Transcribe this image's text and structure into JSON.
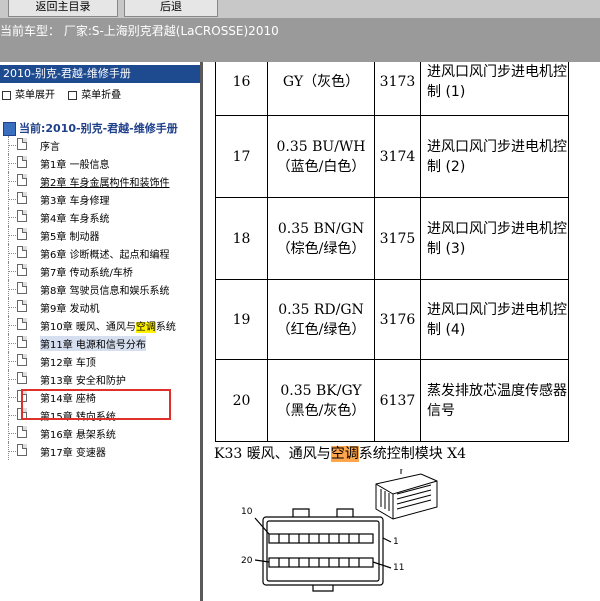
{
  "toolbar": {
    "buttons": [
      "返回主目录",
      "后退"
    ]
  },
  "model_bar": {
    "text": "当前车型：  厂家:S-上海别克君越(LaCROSSE)2010"
  },
  "sidebar": {
    "title": "2010-别克-君越-维修手册",
    "expand_label": "菜单展开",
    "collapse_label": "菜单折叠",
    "root_label": "当前:2010-别克-君越-维修手册",
    "items": [
      {
        "label": "序言"
      },
      {
        "label": "第1章 一般信息"
      },
      {
        "label": "第2章 车身金属构件和装饰件"
      },
      {
        "label": "第3章 车身修理"
      },
      {
        "label": "第4章 车身系统"
      },
      {
        "label": "第5章 制动器"
      },
      {
        "label": "第6章 诊断概述、起点和编程"
      },
      {
        "label": "第7章 传动系统/车桥"
      },
      {
        "label": "第8章 驾驶员信息和娱乐系统"
      },
      {
        "label": "第9章 发动机"
      },
      {
        "label_pre": "第10章 暖风、通风与",
        "label_hl": "空调",
        "label_post": "系统"
      },
      {
        "label": "第11章 电源和信号分布"
      },
      {
        "label": "第12章 车顶"
      },
      {
        "label": "第13章 安全和防护"
      },
      {
        "label": "第14章 座椅"
      },
      {
        "label": "第15章 转向系统"
      },
      {
        "label": "第16章 悬架系统"
      },
      {
        "label": "第17章 变速器"
      }
    ]
  },
  "content": {
    "pin_table": {
      "rows": [
        {
          "pin": "16",
          "wire": "GY（灰色）",
          "circuit": "3173",
          "function": "进风口风门步进电机控制 (1)"
        },
        {
          "pin": "17",
          "wire": "0.35 BU/WH（蓝色/白色）",
          "circuit": "3174",
          "function": "进风口风门步进电机控制 (2)"
        },
        {
          "pin": "18",
          "wire": "0.35 BN/GN（棕色/绿色）",
          "circuit": "3175",
          "function": "进风口风门步进电机控制 (3)"
        },
        {
          "pin": "19",
          "wire": "0.35 RD/GN（红色/绿色）",
          "circuit": "3176",
          "function": "进风口风门步进电机控制 (4)"
        },
        {
          "pin": "20",
          "wire": "0.35 BK/GY（黑色/灰色）",
          "circuit": "6137",
          "function": "蒸发排放芯温度传感器信号"
        }
      ]
    },
    "caption": {
      "pre": "K33 暖风、通风与",
      "highlight": "空调",
      "post": "系统控制模块 X4"
    },
    "connector_labels": {
      "top_left": "10",
      "top_right": "1",
      "bottom_left": "20",
      "bottom_right": "11"
    }
  },
  "colors": {
    "sidebar_title_bg": "#1e4a90",
    "selection_box": "#e0302a",
    "highlight_yellow": "#fff200",
    "highlight_orange": "#ffa64d"
  }
}
